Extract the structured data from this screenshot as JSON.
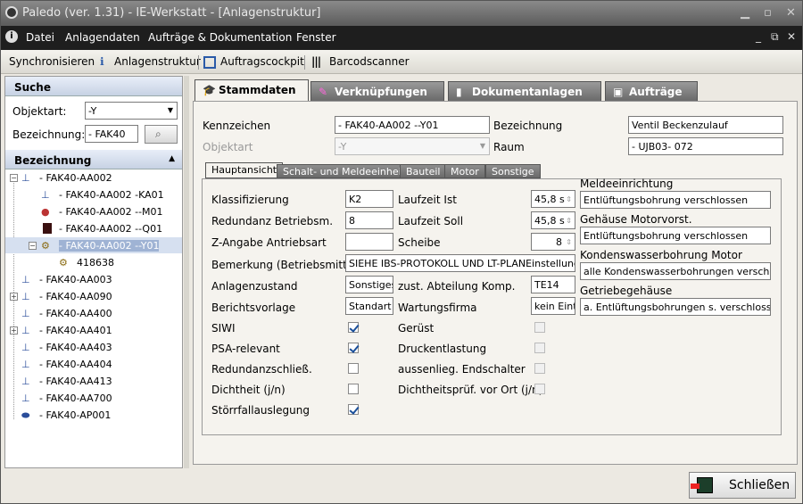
{
  "window": {
    "title": "Paledo (ver. 1.31) - IE-Werkstatt - [Anlagenstruktur]"
  },
  "menu": [
    "Datei",
    "Anlagendaten",
    "Aufträge & Dokumentation",
    "Fenster"
  ],
  "toolbar": {
    "sync": "Synchronisieren",
    "struct": "Anlagenstruktur",
    "cockpit": "Auftragscockpit",
    "barcode": "Barcodscanner"
  },
  "search": {
    "title": "Suche",
    "objektart_label": "Objektart:",
    "objektart_value": "-Y",
    "bezeichnung_label": "Bezeichnung:",
    "bezeichnung_value": "- FAK40"
  },
  "tree": {
    "title": "Bezeichnung",
    "nodes": [
      {
        "label": "- FAK40-AA002"
      },
      {
        "label": "- FAK40-AA002 -KA01"
      },
      {
        "label": "- FAK40-AA002 --M01"
      },
      {
        "label": "- FAK40-AA002 --Q01"
      },
      {
        "label": "- FAK40-AA002 --Y01"
      },
      {
        "label": "418638"
      },
      {
        "label": "- FAK40-AA003"
      },
      {
        "label": "- FAK40-AA090"
      },
      {
        "label": "- FAK40-AA400"
      },
      {
        "label": "- FAK40-AA401"
      },
      {
        "label": "- FAK40-AA403"
      },
      {
        "label": "- FAK40-AA404"
      },
      {
        "label": "- FAK40-AA413"
      },
      {
        "label": "- FAK40-AA700"
      },
      {
        "label": "- FAK40-AP001"
      }
    ]
  },
  "tabs": [
    "Stammdaten",
    "Verknüpfungen",
    "Dokumentanlagen",
    "Aufträge"
  ],
  "stamm": {
    "kennzeichen_label": "Kennzeichen",
    "kennzeichen": "- FAK40-AA002 --Y01",
    "objektart_label": "Objektart",
    "objektart": "-Y",
    "bezeichnung_label": "Bezeichnung",
    "bezeichnung": "Ventil Beckenzulauf",
    "raum_label": "Raum",
    "raum": "- UJB03-  072"
  },
  "subtabs": [
    "Hauptansicht",
    "Schalt- und Meldeeinheit",
    "Bauteil",
    "Motor",
    "Sonstige"
  ],
  "haupt": {
    "klassifizierung_label": "Klassifizierung",
    "klassifizierung": "K2",
    "redundanz_label": "Redundanz Betriebsm.",
    "redundanz": "8",
    "zangabe_label": "Z-Angabe Antriebsart",
    "zangabe": "",
    "bemerkung_label": "Bemerkung (Betriebsmittel)",
    "bemerkung": "SIEHE IBS-PROTOKOLL UND LT-PLANEinstellung der Li",
    "anlagenzustand_label": "Anlagenzustand",
    "anlagenzustand": "Sonstiges",
    "berichtsvorlage_label": "Berichtsvorlage",
    "berichtsvorlage": "Standart S",
    "laufzeit_ist_label": "Laufzeit Ist",
    "laufzeit_ist": "45,8 s",
    "laufzeit_soll_label": "Laufzeit Soll",
    "laufzeit_soll": "45,8 s",
    "scheibe_label": "Scheibe",
    "scheibe": "8",
    "abteilung_label": "zust. Abteilung Komp.",
    "abteilung": "TE14",
    "wartungsfirma_label": "Wartungsfirma",
    "wartungsfirma": "kein Eintr",
    "siwi_label": "SIWI",
    "psa_label": "PSA-relevant",
    "redschl_label": "Redundanzschließ.",
    "dichtheit_label": "Dichtheit (j/n)",
    "stoerfall_label": "Störrfallauslegung",
    "geruest_label": "Gerüst",
    "druck_label": "Druckentlastung",
    "endschalter_label": "aussenlieg. Endschalter",
    "dichtpruef_label": "Dichtheitsprüf. vor Ort (j/n)",
    "melde_label": "Meldeeinrichtung",
    "melde": "Entlüftungsbohrung verschlossen",
    "gehaeuse_label": "Gehäuse Motorvorst.",
    "gehaeuse": "Entlüftungsbohrung verschlossen",
    "konden_label": "Kondenswasserbohrung Motor",
    "konden": "alle Kondenswasserbohrungen verschlossen",
    "getriebe_label": "Getriebegehäuse",
    "getriebe": "a. Entlüftungsbohrungen s. verschlossen"
  },
  "checks": {
    "siwi": true,
    "psa": true,
    "redschl": false,
    "dichtheit": false,
    "stoerfall": true,
    "geruest": false,
    "druck": false,
    "endschalter": false,
    "dichtpruef": false
  },
  "close_button": "Schließen"
}
